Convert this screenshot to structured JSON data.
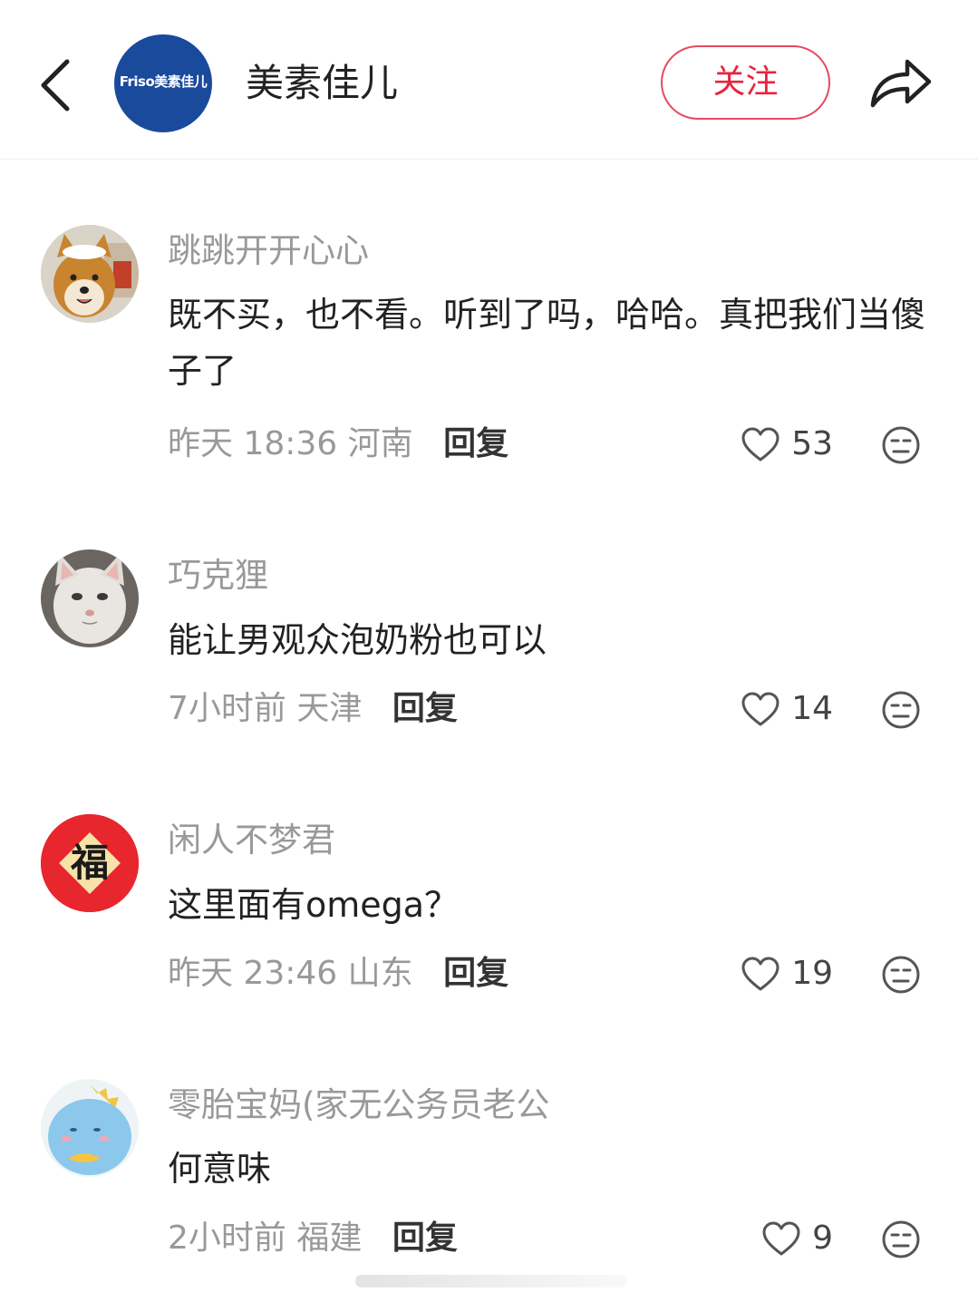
{
  "header": {
    "brand_name": "美素佳儿",
    "brand_logo_text": "Friso美素佳儿",
    "follow_label": "关注"
  },
  "colors": {
    "accent": "#e8233e",
    "meta_text": "#999999",
    "brand_blue": "#1a4a9c"
  },
  "comments": [
    {
      "username": "跳跳开开心心",
      "content": "既不买，也不看。听到了吗，哈哈。真把我们当傻子了",
      "time": "昨天 18:36",
      "location": "河南",
      "reply_label": "回复",
      "likes": "53"
    },
    {
      "username": "巧克狸",
      "content": "能让男观众泡奶粉也可以",
      "time": "7小时前",
      "location": "天津",
      "reply_label": "回复",
      "likes": "14"
    },
    {
      "username": "闲人不梦君",
      "content": "这里面有omega？",
      "time": "昨天 23:46",
      "location": "山东",
      "reply_label": "回复",
      "likes": "19",
      "avatar_text": "福"
    },
    {
      "username": "零胎宝妈(家无公务员老公",
      "content": "何意味",
      "time": "2小时前",
      "location": "福建",
      "reply_label": "回复",
      "likes": "9"
    }
  ]
}
